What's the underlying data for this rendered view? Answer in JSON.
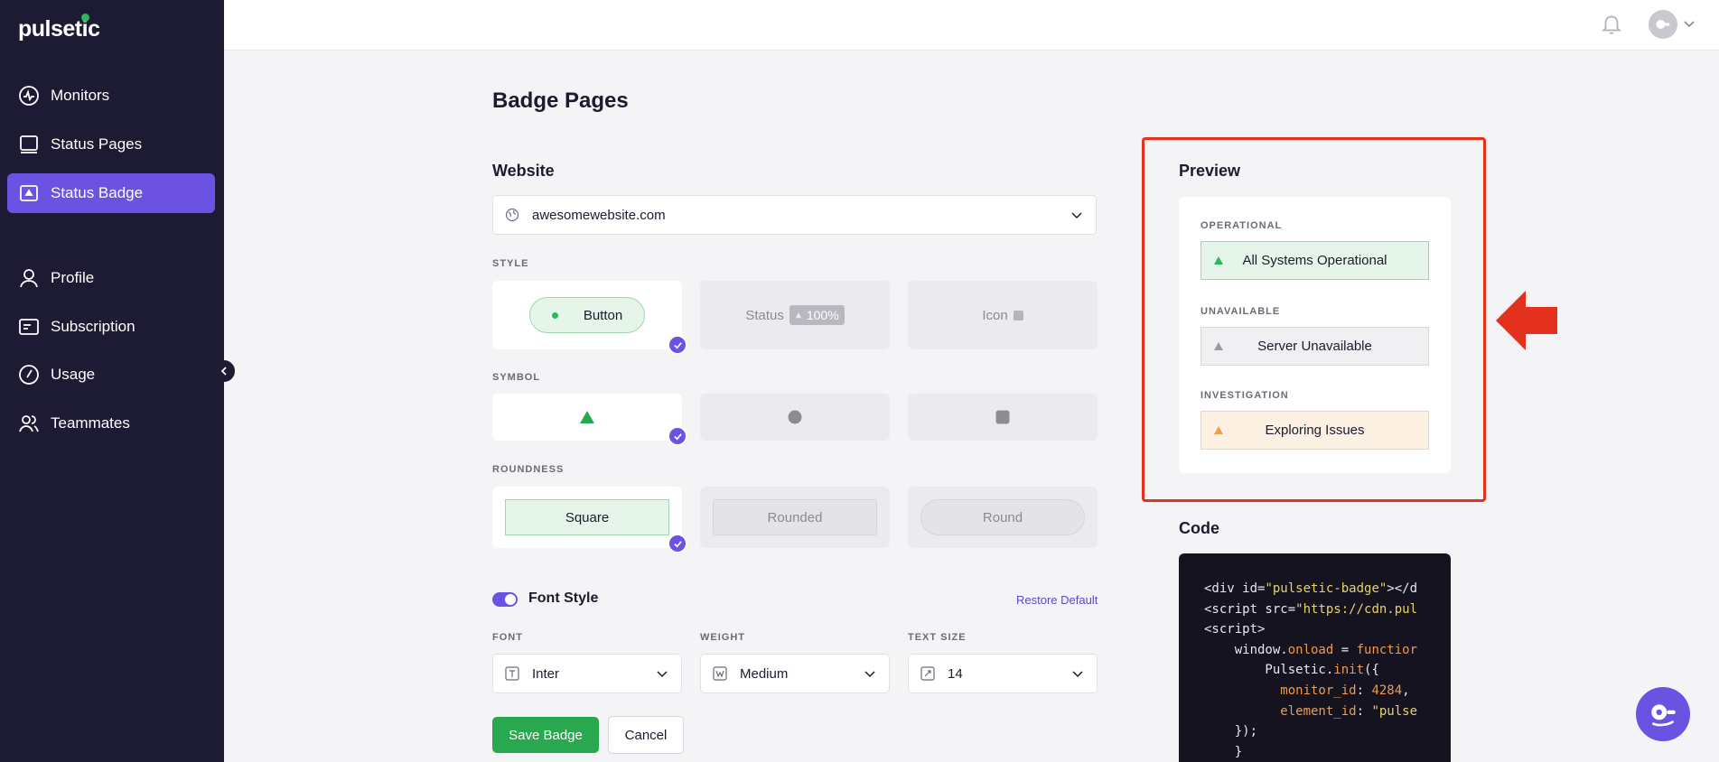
{
  "brand": {
    "name": "pulsetic"
  },
  "sidebar": {
    "items": [
      {
        "label": "Monitors",
        "icon": "pulse-icon"
      },
      {
        "label": "Status Pages",
        "icon": "monitor-icon"
      },
      {
        "label": "Status Badge",
        "icon": "badge-icon",
        "active": true
      },
      {
        "label": "Profile",
        "icon": "user-icon"
      },
      {
        "label": "Subscription",
        "icon": "card-icon"
      },
      {
        "label": "Usage",
        "icon": "gauge-icon"
      },
      {
        "label": "Teammates",
        "icon": "users-icon"
      }
    ]
  },
  "page": {
    "title": "Badge Pages"
  },
  "website": {
    "heading": "Website",
    "value": "awesomewebsite.com"
  },
  "style": {
    "caption": "STYLE",
    "options": [
      {
        "label": "Button",
        "selected": true
      },
      {
        "label": "Status",
        "tag": "100%"
      },
      {
        "label": "Icon"
      }
    ]
  },
  "symbol": {
    "caption": "SYMBOL"
  },
  "roundness": {
    "caption": "ROUNDNESS",
    "options": [
      "Square",
      "Rounded",
      "Round"
    ]
  },
  "font_style": {
    "label": "Font Style",
    "restore": "Restore Default",
    "enabled": true,
    "font_caption": "FONT",
    "font_value": "Inter",
    "weight_caption": "WEIGHT",
    "weight_value": "Medium",
    "size_caption": "TEXT SIZE",
    "size_value": "14"
  },
  "actions": {
    "save": "Save Badge",
    "cancel": "Cancel"
  },
  "preview": {
    "heading": "Preview",
    "items": [
      {
        "caption": "OPERATIONAL",
        "text": "All Systems Operational",
        "color": "#2eb85c"
      },
      {
        "caption": "UNAVAILABLE",
        "text": "Server Unavailable",
        "color": "#9a9aa3"
      },
      {
        "caption": "INVESTIGATION",
        "text": "Exploring Issues",
        "color": "#f0a04b"
      }
    ]
  },
  "code": {
    "heading": "Code",
    "lines": {
      "l1a": "<div id=",
      "l1b": "\"pulsetic-badge\"",
      "l1c": "></d",
      "l2a": "<script src=",
      "l2b": "\"https://cdn.pul",
      "l3": "<script>",
      "l4a": "    window.",
      "l4b": "onload",
      "l4c": " = ",
      "l4d": "functior",
      "l5a": "        Pulsetic.",
      "l5b": "init",
      "l5c": "({",
      "l6a": "          monitor_id",
      "l6b": ": ",
      "l6c": "4284",
      "l7a": "          element_id",
      "l7b": ": ",
      "l7c": "\"pulse",
      "l8": "    });",
      "l9": "    }"
    }
  },
  "colors": {
    "accent": "#6c52e2",
    "sidebar": "#1d1b33",
    "success": "#2aa84f",
    "highlight": "#e3301f"
  }
}
